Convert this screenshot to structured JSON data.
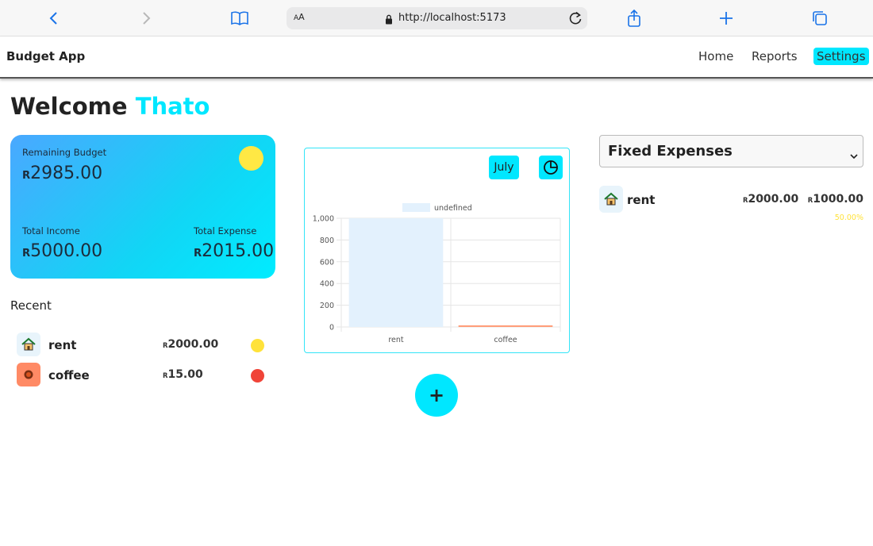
{
  "browser": {
    "text_size_label": "AA",
    "url": "http://localhost:5173"
  },
  "nav": {
    "brand": "Budget App",
    "links": [
      "Home",
      "Reports",
      "Settings"
    ],
    "active": "Settings"
  },
  "welcome": {
    "greeting": "Welcome",
    "name": "Thato"
  },
  "budget_card": {
    "remaining_label": "Remaining Budget",
    "remaining_currency": "R",
    "remaining_value": "2985.00",
    "income_label": "Total Income",
    "income_currency": "R",
    "income_value": "5000.00",
    "expense_label": "Total Expense",
    "expense_currency": "R",
    "expense_value": "2015.00"
  },
  "recent": {
    "title": "Recent",
    "items": [
      {
        "icon": "house-icon",
        "name": "rent",
        "currency": "R",
        "amount": "2000.00",
        "status_color": "#ffe23a",
        "icon_bg": "#e8f4fb"
      },
      {
        "icon": "food-icon",
        "name": "coffee",
        "currency": "R",
        "amount": "15.00",
        "status_color": "#f04438",
        "icon_bg": "#ff8a65"
      }
    ]
  },
  "chart_panel": {
    "month": "July"
  },
  "chart_data": {
    "type": "bar",
    "legend": [
      "undefined"
    ],
    "categories": [
      "rent",
      "coffee"
    ],
    "values": [
      2000,
      15
    ],
    "colors": [
      "#e3f1fd",
      "#ff9e7a"
    ],
    "ylim": [
      0,
      1000
    ],
    "yticks": [
      0,
      200,
      400,
      600,
      800,
      1000
    ],
    "ytick_labels": [
      "0",
      "200",
      "400",
      "600",
      "800",
      "1,000"
    ],
    "grid": true,
    "legend_position": "top-center"
  },
  "add_button": "+",
  "fixed_expenses": {
    "selected": "Fixed Expenses",
    "items": [
      {
        "icon": "house-icon",
        "name": "rent",
        "currency": "R",
        "amount": "2000.00",
        "currency2": "R",
        "paid": "1000.00",
        "percent": "50.00%",
        "percent_color": "#ffe23a"
      }
    ]
  }
}
